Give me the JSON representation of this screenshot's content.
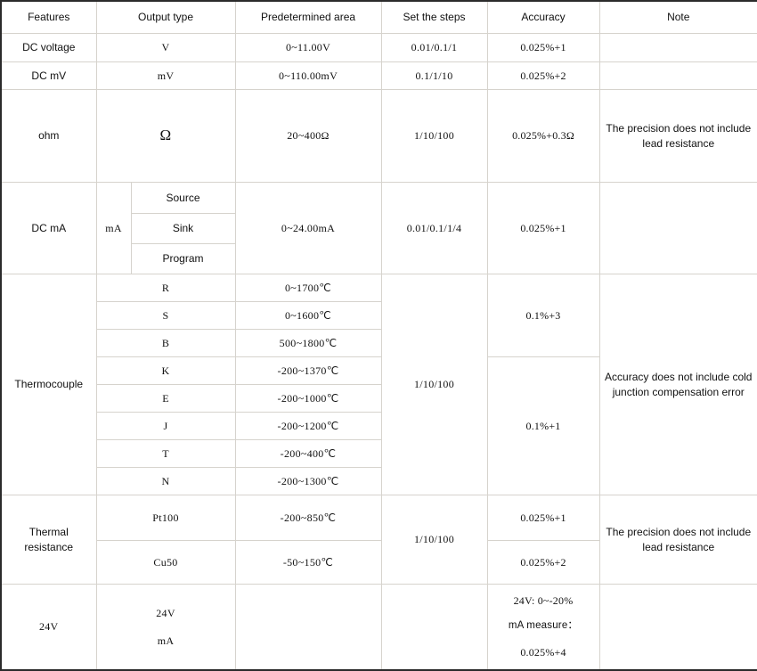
{
  "table": {
    "headers": [
      "Features",
      "Output type",
      "Predetermined area",
      "Set the steps",
      "Accuracy",
      "Note"
    ],
    "rows": {
      "dc_voltage": {
        "feature": "DC voltage",
        "output_type": "V",
        "predetermined_area": "0~11.00V",
        "set_the_steps": "0.01/0.1/1",
        "accuracy": "0.025%+1",
        "note": ""
      },
      "dc_mv": {
        "feature": "DC mV",
        "output_type": "mV",
        "predetermined_area": "0~110.00mV",
        "set_the_steps": "0.1/1/10",
        "accuracy": "0.025%+2",
        "note": ""
      },
      "ohm": {
        "feature": "ohm",
        "output_type": "Ω",
        "predetermined_area": "20~400Ω",
        "set_the_steps": "1/10/100",
        "accuracy": "0.025%+0.3Ω",
        "note": "The precision does not include lead resistance"
      },
      "dc_ma": {
        "feature": "DC mA",
        "output_type": "mA",
        "modes": [
          "Source",
          "Sink",
          "Program"
        ],
        "predetermined_area": "0~24.00mA",
        "set_the_steps": "0.01/0.1/1/4",
        "accuracy": "0.025%+1",
        "note": ""
      },
      "thermocouple": {
        "feature": "Thermocouple",
        "set_the_steps": "1/10/100",
        "note": "Accuracy does not include cold junction compensation error",
        "types": [
          {
            "output_type": "R",
            "predetermined_area": "0~1700℃"
          },
          {
            "output_type": "S",
            "predetermined_area": "0~1600℃"
          },
          {
            "output_type": "B",
            "predetermined_area": "500~1800℃"
          },
          {
            "output_type": "K",
            "predetermined_area": "-200~1370℃"
          },
          {
            "output_type": "E",
            "predetermined_area": "-200~1000℃"
          },
          {
            "output_type": "J",
            "predetermined_area": "-200~1200℃"
          },
          {
            "output_type": "T",
            "predetermined_area": "-200~400℃"
          },
          {
            "output_type": "N",
            "predetermined_area": "-200~1300℃"
          }
        ],
        "accuracy_high": "0.1%+3",
        "accuracy_low": "0.1%+1"
      },
      "thermal_resistance": {
        "feature_line1": "Thermal",
        "feature_line2": "resistance",
        "set_the_steps": "1/10/100",
        "note": "The precision does not include lead resistance",
        "types": [
          {
            "output_type": "Pt100",
            "predetermined_area": "-200~850℃",
            "accuracy": "0.025%+1"
          },
          {
            "output_type": "Cu50",
            "predetermined_area": "-50~150℃",
            "accuracy": "0.025%+2"
          }
        ]
      },
      "v24": {
        "feature": "24V",
        "output_type_line1": "24V",
        "output_type_line2": "mA",
        "predetermined_area": "",
        "set_the_steps": "",
        "accuracy_line1": "24V: 0~-20%",
        "accuracy_line2": "mA measure：",
        "accuracy_line3": "0.025%+4",
        "note": ""
      }
    }
  },
  "colors": {
    "outer_border": "#2b2b2b",
    "grid_line": "#d6d3cd",
    "text": "#111111",
    "background": "#ffffff"
  }
}
